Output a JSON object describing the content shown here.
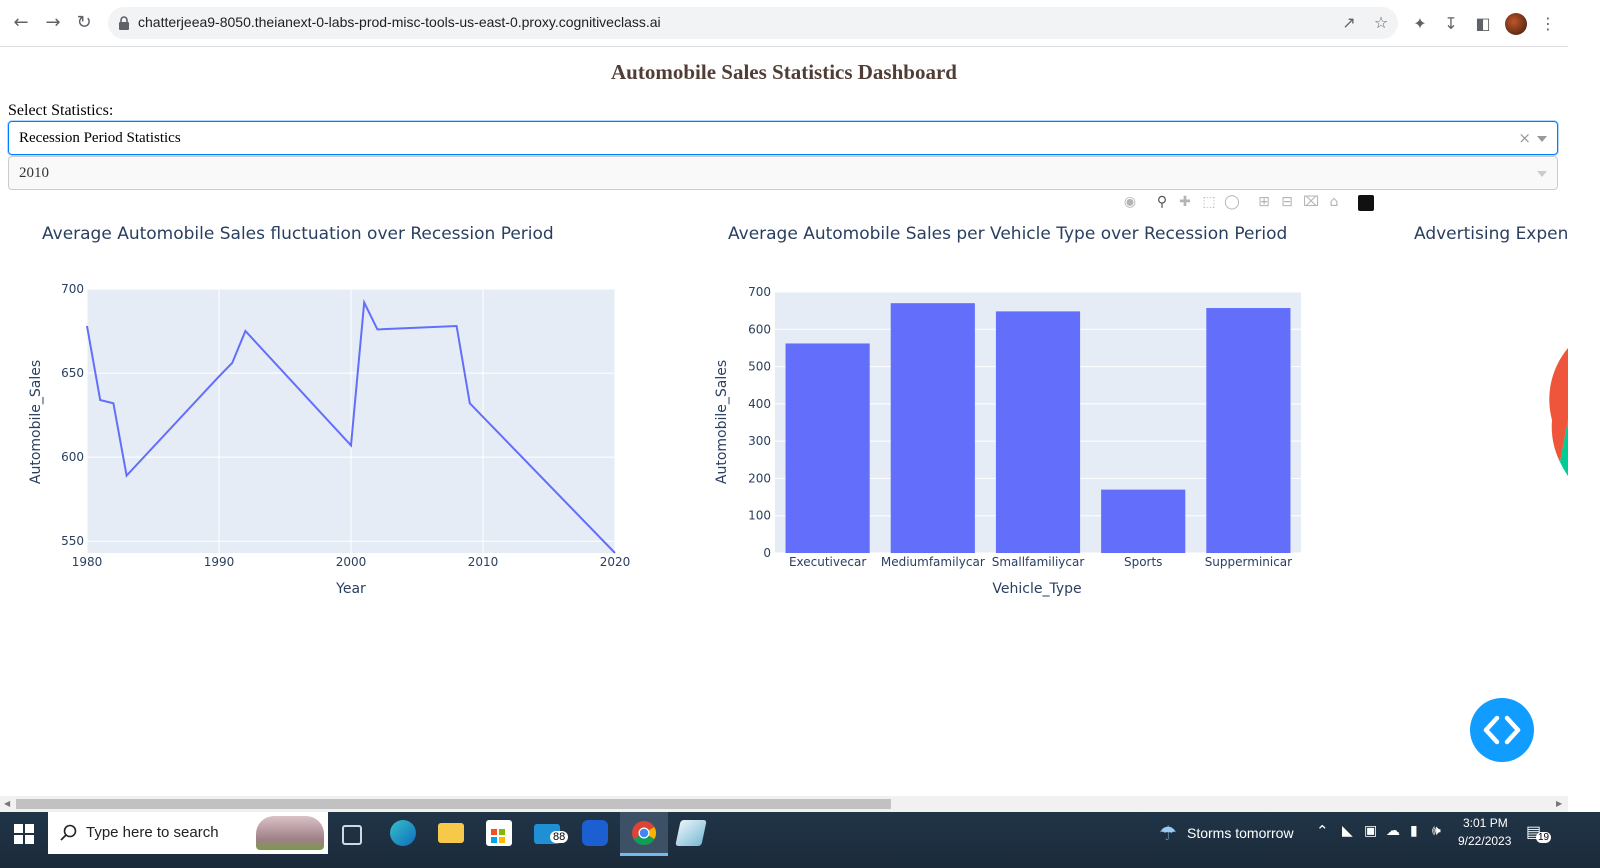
{
  "browser": {
    "url": "chatterjeea9-8050.theianext-0-labs-prod-misc-tools-us-east-0.proxy.cognitiveclass.ai"
  },
  "page": {
    "title": "Automobile Sales Statistics Dashboard",
    "select_label": "Select Statistics:",
    "statistics_dropdown": {
      "value": "Recession Period Statistics",
      "clear": "×"
    },
    "year_dropdown": {
      "value": "2010"
    }
  },
  "charts": {
    "line_title": "Average Automobile Sales fluctuation over Recession Period",
    "bar_title": "Average Automobile Sales per Vehicle Type over Recession Period",
    "pie_title_partial": "Advertising Expen"
  },
  "chart_data": [
    {
      "type": "line",
      "title": "Average Automobile Sales fluctuation over Recession Period",
      "xlabel": "Year",
      "ylabel": "Automobile_Sales",
      "xlim": [
        1980,
        2020
      ],
      "ylim": [
        543,
        700
      ],
      "xticks": [
        1980,
        1990,
        2000,
        2010,
        2020
      ],
      "yticks": [
        550,
        600,
        650,
        700
      ],
      "color": "#636efa",
      "x": [
        1980,
        1981,
        1982,
        1983,
        1990,
        1991,
        1992,
        2000,
        2001,
        2002,
        2008,
        2009,
        2020
      ],
      "y": [
        678,
        634,
        632,
        589,
        648,
        656,
        675,
        607,
        692,
        676,
        678,
        632,
        543
      ]
    },
    {
      "type": "bar",
      "title": "Average Automobile Sales per Vehicle Type over Recession Period",
      "xlabel": "Vehicle_Type",
      "ylabel": "Automobile_Sales",
      "ylim": [
        0,
        700
      ],
      "yticks": [
        0,
        100,
        200,
        300,
        400,
        500,
        600,
        700
      ],
      "color": "#636efa",
      "categories": [
        "Executivecar",
        "Mediumfamilycar",
        "Smallfamiliycar",
        "Sports",
        "Supperminicar"
      ],
      "values": [
        562,
        670,
        648,
        170,
        657
      ]
    }
  ],
  "taskbar": {
    "search_placeholder": "Type here to search",
    "mail_badge": "88",
    "weather": "Storms tomorrow",
    "time": "3:01 PM",
    "date": "9/22/2023",
    "notifications": "19"
  }
}
